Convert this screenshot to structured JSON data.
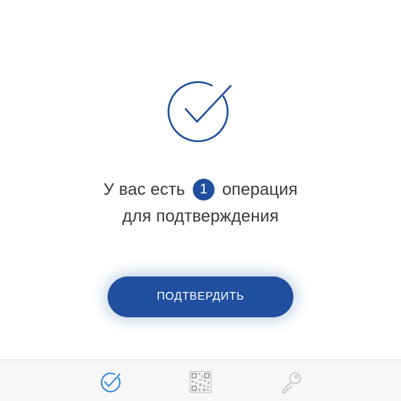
{
  "message": {
    "line1_before": "У вас есть",
    "count": "1",
    "line1_after": "операция",
    "line2": "для подтверждения"
  },
  "confirm_button": {
    "label": "ПОДТВЕРДИТЬ"
  },
  "icons": {
    "hero": "check-circle-icon",
    "tabs": [
      "check-circle-icon",
      "qr-code-icon",
      "key-icon"
    ]
  },
  "tab_bar": {
    "active_tab": "operations"
  },
  "colors": {
    "accent": "#1f4f9e",
    "active_tab": "#2e86de",
    "inactive_tab": "#c4c4c4",
    "text": "#3a3a3a"
  }
}
